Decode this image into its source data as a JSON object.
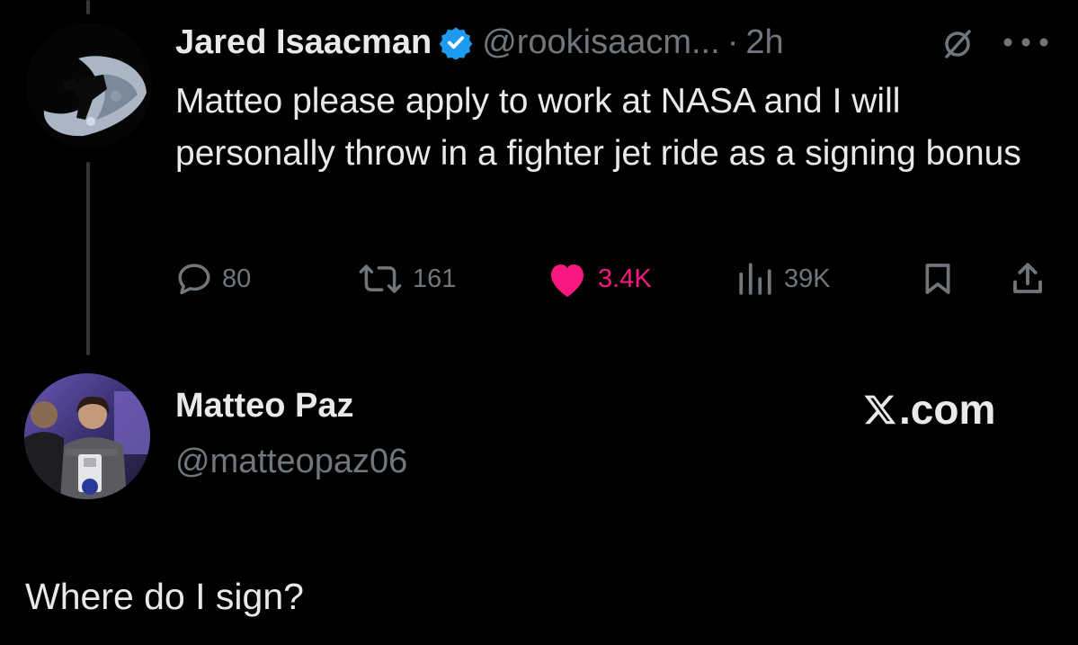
{
  "tweet": {
    "author": {
      "name": "Jared Isaacman",
      "handle": "@rookisaacm...",
      "verified": true,
      "avatar_icon": "moon-silhouette-avatar"
    },
    "separator": "·",
    "time": "2h",
    "text": "Matteo please apply to work at NASA and I will personally throw in a fighter jet ride as a signing bonus",
    "actions": {
      "replies": "80",
      "reposts": "161",
      "likes": "3.4K",
      "views": "39K"
    },
    "icons": {
      "reply": "reply-icon",
      "repost": "repost-icon",
      "like": "heart-icon",
      "views": "analytics-icon",
      "bookmark": "bookmark-icon",
      "share": "share-icon",
      "grok": "grok-icon",
      "more": "more-icon"
    }
  },
  "reply": {
    "author": {
      "name": "Matteo Paz",
      "handle": "@matteopaz06",
      "avatar_icon": "photo-avatar"
    },
    "text": "Where do I sign?"
  },
  "watermark": {
    "label": ".com",
    "icon": "x-logo-icon"
  },
  "colors": {
    "background": "#000000",
    "primary_text": "#e7e9ea",
    "secondary_text": "#71767b",
    "like": "#f91880",
    "verified": "#1d9bf0",
    "thread_line": "#333639"
  }
}
